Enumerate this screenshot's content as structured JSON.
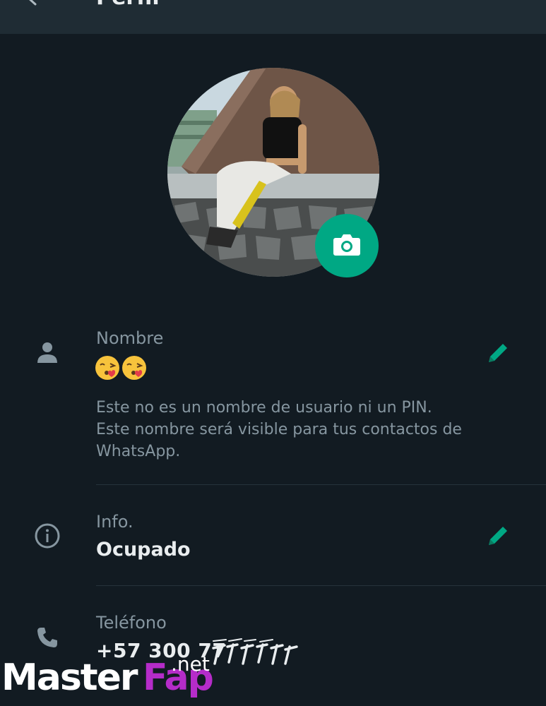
{
  "header": {
    "title": "Perfil",
    "back_icon": "arrow-back-icon"
  },
  "avatar": {
    "camera_icon": "camera-icon",
    "accent_color": "#00a884"
  },
  "name_section": {
    "icon": "person-icon",
    "label": "Nombre",
    "value": "😘😘",
    "description_line1": "Este no es un nombre de usuario ni un PIN.",
    "description_line2": "Este nombre será visible para tus contactos de",
    "description_line3": "WhatsApp.",
    "edit_icon": "pencil-icon"
  },
  "info_section": {
    "icon": "info-icon",
    "label": "Info.",
    "value": "Ocupado",
    "edit_icon": "pencil-icon"
  },
  "phone_section": {
    "icon": "phone-icon",
    "label": "Teléfono",
    "value": "+57 300 77"
  },
  "watermark": {
    "part1": "Master",
    "part2": "Fap",
    "part3": ".net"
  },
  "colors": {
    "background": "#121b22",
    "appbar": "#1f2c34",
    "accent": "#00a884",
    "secondary_text": "#8696a0",
    "primary_text": "#e9edef"
  }
}
